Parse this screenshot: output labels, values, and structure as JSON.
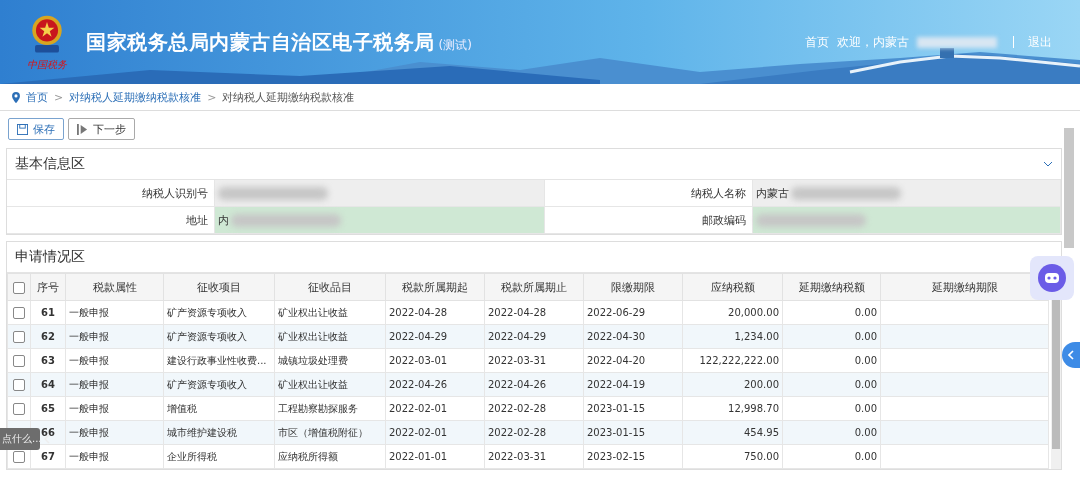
{
  "header": {
    "title": "国家税务总局内蒙古自治区电子税务局",
    "title_suffix": "(测试)",
    "logo_text": "中国税务",
    "nav": [
      {
        "label": "首页"
      },
      {
        "label": "欢迎，内蒙古",
        "blurred_tail": true
      },
      {
        "label": "退出"
      }
    ]
  },
  "breadcrumb": [
    {
      "label": "首页",
      "link": true
    },
    {
      "separator": ">"
    },
    {
      "label": "对纳税人延期缴纳税款核准",
      "link": true
    },
    {
      "separator": ">"
    },
    {
      "label": "对纳税人延期缴纳税款核准",
      "link": false
    }
  ],
  "toolbar": [
    {
      "label": "保存",
      "kind": "save"
    },
    {
      "label": "下一步",
      "kind": "next"
    }
  ],
  "basic_info": {
    "title": "基本信息区",
    "expanded": true,
    "fields": [
      {
        "label": "纳税人识别号",
        "blurred": true,
        "editable": false
      },
      {
        "label": "纳税人名称",
        "value": "内蒙古",
        "blurred": true,
        "editable": false
      },
      {
        "label": "地址",
        "value": "内",
        "blurred": true,
        "editable": true
      },
      {
        "label": "邮政编码",
        "blurred": true,
        "editable": true
      }
    ]
  },
  "application": {
    "title": "申请情况区",
    "header_checked": false,
    "columns": [
      "序号",
      "税款属性",
      "征收项目",
      "征收品目",
      "税款所属期起",
      "税款所属期止",
      "限缴期限",
      "应纳税额",
      "延期缴纳税额",
      "延期缴纳期限"
    ],
    "rows": [
      {
        "checked": false,
        "cells": [
          "61",
          "一般申报",
          "矿产资源专项收入",
          "矿业权出让收益",
          "2022-04-28",
          "2022-04-28",
          "2022-06-29",
          "20,000.00",
          "0.00"
        ]
      },
      {
        "checked": false,
        "cells": [
          "62",
          "一般申报",
          "矿产资源专项收入",
          "矿业权出让收益",
          "2022-04-29",
          "2022-04-29",
          "2022-04-30",
          "1,234.00",
          "0.00"
        ]
      },
      {
        "checked": false,
        "cells": [
          "63",
          "一般申报",
          "建设行政事业性收费...",
          "城镇垃圾处理费",
          "2022-03-01",
          "2022-03-31",
          "2022-04-20",
          "122,222,222.00",
          "0.00"
        ]
      },
      {
        "checked": false,
        "cells": [
          "64",
          "一般申报",
          "矿产资源专项收入",
          "矿业权出让收益",
          "2022-04-26",
          "2022-04-26",
          "2022-04-19",
          "200.00",
          "0.00"
        ]
      },
      {
        "checked": false,
        "cells": [
          "65",
          "一般申报",
          "增值税",
          "工程勘察勘探服务",
          "2022-02-01",
          "2022-02-28",
          "2023-01-15",
          "12,998.70",
          "0.00"
        ]
      },
      {
        "cells": [
          "66",
          "一般申报",
          "城市维护建设税",
          "市区（增值税附征）",
          "2022-02-01",
          "2022-02-28",
          "2023-01-15",
          "454.95",
          "0.00"
        ]
      },
      {
        "checked": false,
        "cells": [
          "67",
          "一般申报",
          "企业所得税",
          "应纳税所得额",
          "2022-01-01",
          "2022-03-31",
          "2023-02-15",
          "750.00",
          "0.00"
        ]
      }
    ]
  },
  "chat_widget": {
    "placeholder": "点什么..."
  }
}
